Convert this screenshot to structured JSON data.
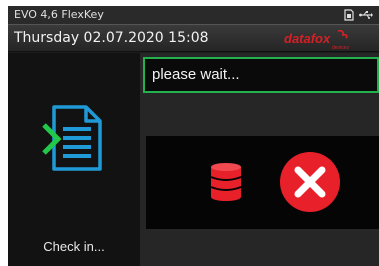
{
  "statusbar": {
    "title": "EVO 4,6 FlexKey",
    "icons": [
      "sim-card-icon",
      "usb-icon"
    ]
  },
  "datebar": {
    "datetime": "Thursday 02.07.2020 15:08",
    "logo_text": "datafox",
    "logo_subtext": "devices"
  },
  "left_panel": {
    "icon": "check-in-document-icon",
    "label": "Check in..."
  },
  "right_panel": {
    "message": "please wait...",
    "status_icons": [
      "database-icon",
      "error-x-icon"
    ]
  },
  "colors": {
    "accent_green": "#22b14c",
    "error_red": "#e8202a",
    "document_blue": "#1f9ad6",
    "arrow_green": "#22c84a",
    "logo_red": "#d81f26"
  }
}
